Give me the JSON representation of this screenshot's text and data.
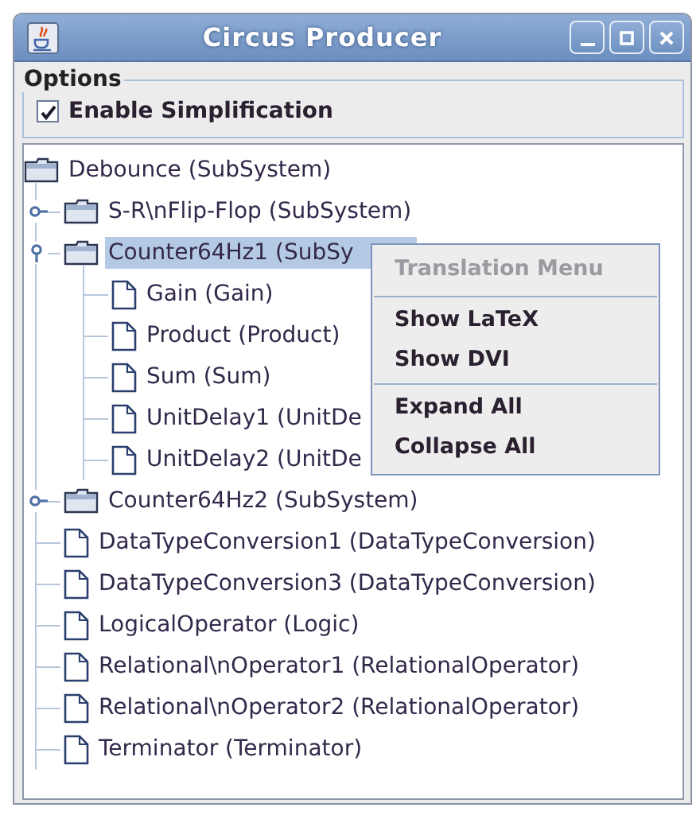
{
  "window": {
    "title": "Circus Producer"
  },
  "options": {
    "title": "Options",
    "checkbox": {
      "label": "Enable Simplification",
      "checked": true
    }
  },
  "tree": {
    "root": {
      "label": "Debounce (SubSystem)",
      "kind": "folder",
      "selected": false,
      "children": [
        {
          "label": "S-R\\nFlip-Flop (SubSystem)",
          "kind": "folder",
          "expanded": false,
          "selected": false
        },
        {
          "label": "Counter64Hz1 (SubSy",
          "kind": "folder",
          "expanded": true,
          "selected": true,
          "children": [
            {
              "label": "Gain (Gain)",
              "kind": "file",
              "selected": false
            },
            {
              "label": "Product (Product)",
              "kind": "file",
              "selected": false
            },
            {
              "label": "Sum (Sum)",
              "kind": "file",
              "selected": false
            },
            {
              "label": "UnitDelay1 (UnitDe",
              "kind": "file",
              "selected": false
            },
            {
              "label": "UnitDelay2 (UnitDe",
              "kind": "file",
              "selected": false
            }
          ]
        },
        {
          "label": "Counter64Hz2 (SubSystem)",
          "kind": "folder",
          "expanded": false,
          "selected": false
        },
        {
          "label": "DataTypeConversion1 (DataTypeConversion)",
          "kind": "file",
          "selected": false
        },
        {
          "label": "DataTypeConversion3 (DataTypeConversion)",
          "kind": "file",
          "selected": false
        },
        {
          "label": "LogicalOperator (Logic)",
          "kind": "file",
          "selected": false
        },
        {
          "label": "Relational\\nOperator1 (RelationalOperator)",
          "kind": "file",
          "selected": false
        },
        {
          "label": "Relational\\nOperator2 (RelationalOperator)",
          "kind": "file",
          "selected": false
        },
        {
          "label": "Terminator (Terminator)",
          "kind": "file",
          "selected": false
        }
      ]
    }
  },
  "context_menu": {
    "groups": [
      {
        "items": [
          {
            "label": "Translation Menu",
            "disabled": true
          }
        ]
      },
      {
        "items": [
          {
            "label": "Show LaTeX",
            "disabled": false
          },
          {
            "label": "Show DVI",
            "disabled": false
          }
        ]
      },
      {
        "items": [
          {
            "label": "Expand All",
            "disabled": false
          },
          {
            "label": "Collapse All",
            "disabled": false
          }
        ]
      }
    ]
  }
}
